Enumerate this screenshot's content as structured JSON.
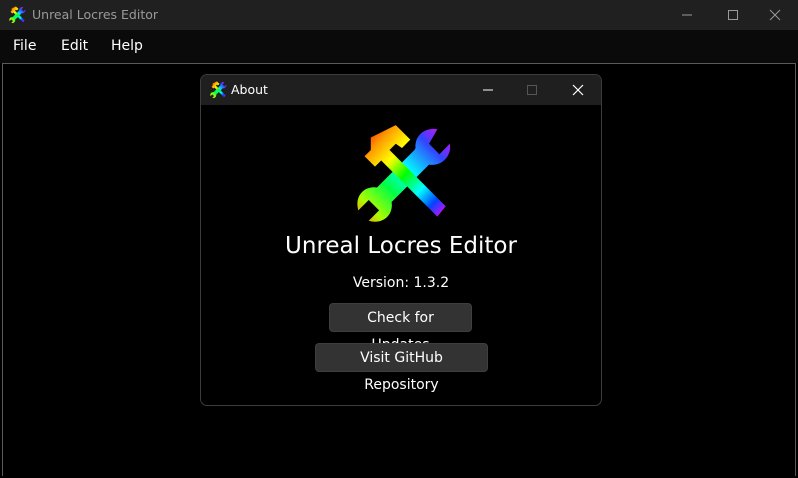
{
  "window": {
    "title": "Unreal Locres Editor",
    "icon": "hammer-wrench-icon"
  },
  "menubar": {
    "items": [
      {
        "label": "File"
      },
      {
        "label": "Edit"
      },
      {
        "label": "Help"
      }
    ]
  },
  "about": {
    "title": "About",
    "app_name": "Unreal Locres Editor",
    "version": "Version: 1.3.2",
    "check_updates_label": "Check for Updates",
    "github_label": "Visit GitHub Repository"
  },
  "colors": {
    "background": "#000000",
    "titlebar": "#202020",
    "button": "#333333",
    "text": "#ffffff"
  }
}
